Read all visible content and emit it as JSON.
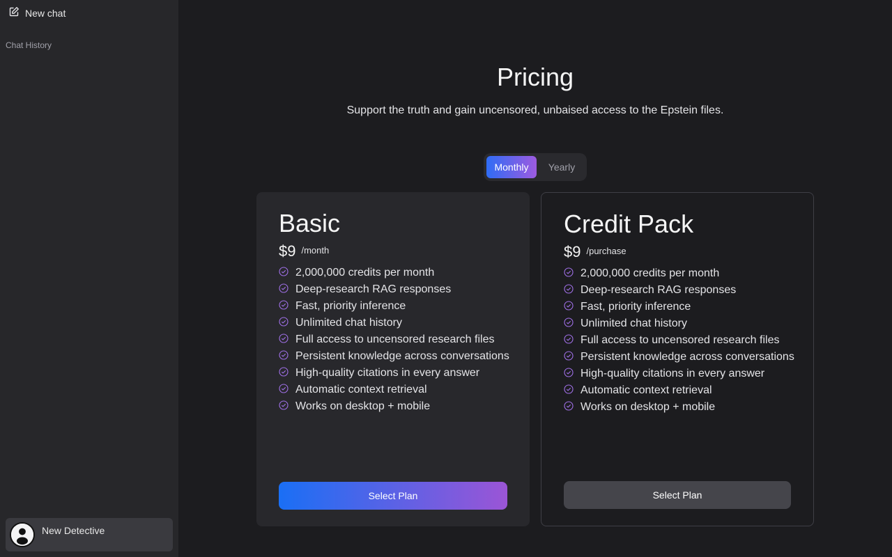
{
  "sidebar": {
    "new_chat_label": "New chat",
    "history_title": "Chat History",
    "user_name": "New Detective"
  },
  "header": {
    "title": "Pricing",
    "subtitle": "Support the truth and gain uncensored, unbaised access to the Epstein files."
  },
  "billing_toggle": {
    "options": [
      "Monthly",
      "Yearly"
    ],
    "selected": "Monthly"
  },
  "plans": [
    {
      "name": "Basic",
      "price": "$9",
      "period": "/month",
      "features": [
        "2,000,000 credits per month",
        "Deep-research RAG responses",
        "Fast, priority inference",
        "Unlimited chat history",
        "Full access to uncensored research files",
        "Persistent knowledge across conversations",
        "High-quality citations in every answer",
        "Automatic context retrieval",
        "Works on desktop + mobile"
      ],
      "button_label": "Select Plan"
    },
    {
      "name": "Credit Pack",
      "price": "$9",
      "period": "/purchase",
      "features": [
        "2,000,000 credits per month",
        "Deep-research RAG responses",
        "Fast, priority inference",
        "Unlimited chat history",
        "Full access to uncensored research files",
        "Persistent knowledge across conversations",
        "High-quality citations in every answer",
        "Automatic context retrieval",
        "Works on desktop + mobile"
      ],
      "button_label": "Select Plan"
    }
  ],
  "colors": {
    "accent_start": "#1a6ff5",
    "accent_end": "#9b55d6",
    "check_icon": "#a070e8"
  }
}
